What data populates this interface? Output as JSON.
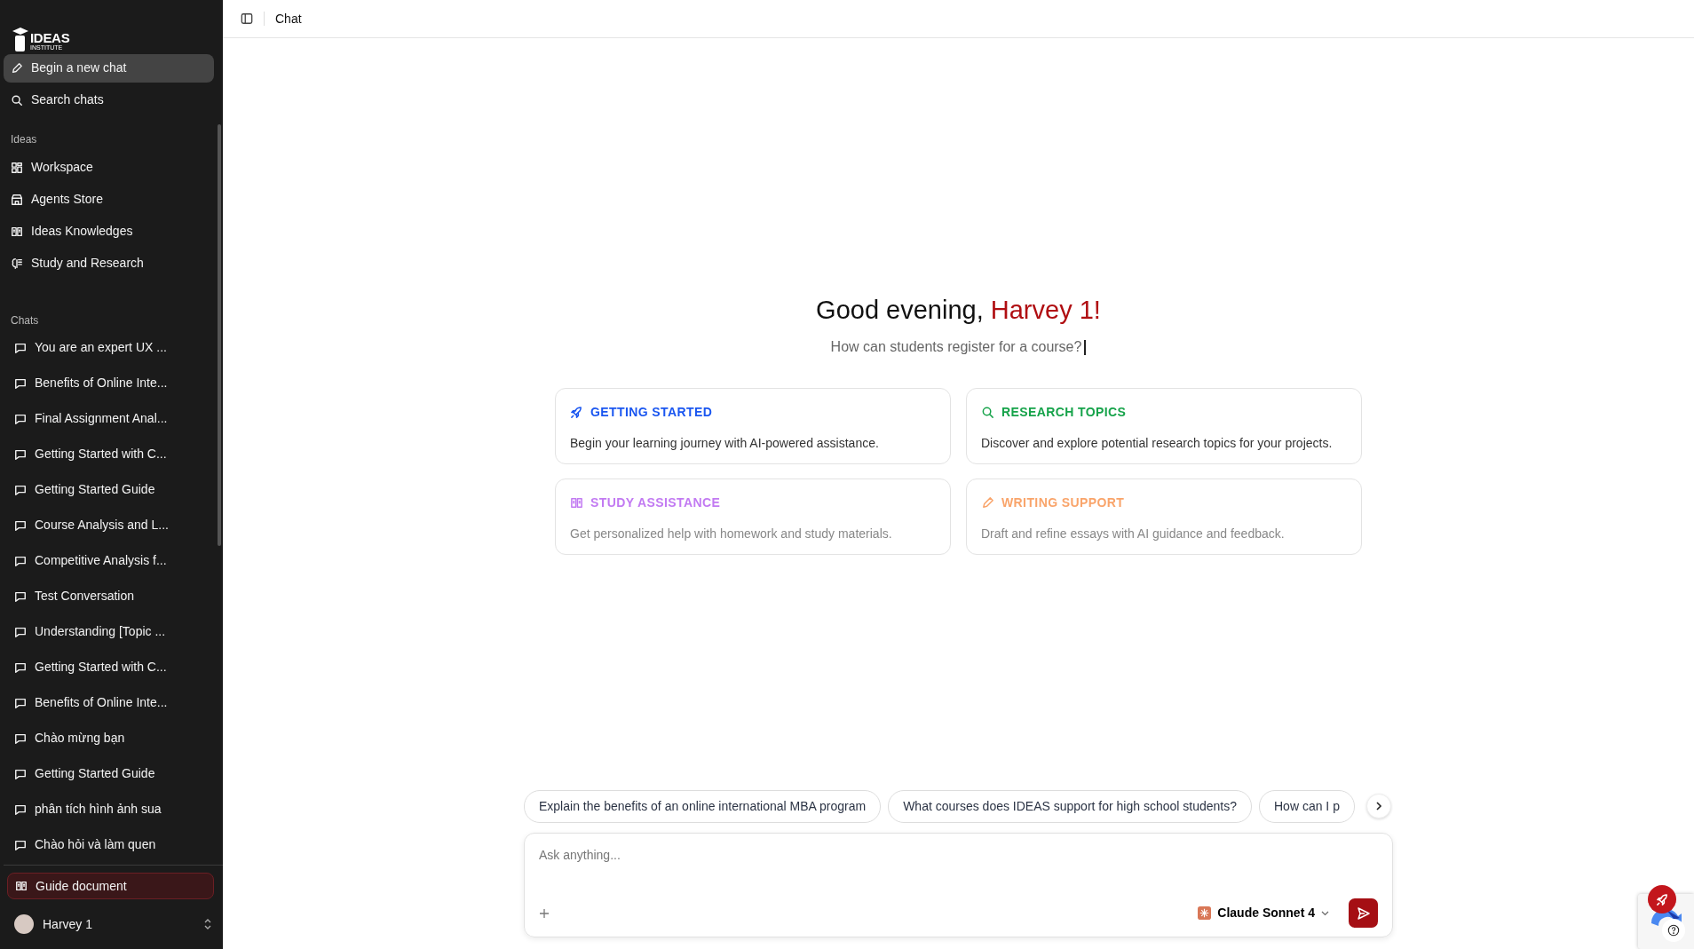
{
  "logo": {
    "title": "IDEAS",
    "subtitle": "INSTITUTE"
  },
  "sidebar": {
    "actions": [
      {
        "label": "Begin a new chat",
        "kind": "pencil",
        "selected": true
      },
      {
        "label": "Search chats",
        "kind": "search",
        "selected": false
      }
    ],
    "sections": [
      {
        "heading": "Ideas",
        "items": [
          {
            "label": "Workspace",
            "kind": "grid"
          },
          {
            "label": "Agents Store",
            "kind": "store"
          },
          {
            "label": "Ideas Knowledges",
            "kind": "book"
          },
          {
            "label": "Study and Research",
            "kind": "brain"
          }
        ]
      },
      {
        "heading": "Chats",
        "items": [
          {
            "label": "You are an expert UX ...",
            "kind": "chat"
          },
          {
            "label": "Benefits of Online Inte...",
            "kind": "chat"
          },
          {
            "label": "Final Assignment Anal...",
            "kind": "chat"
          },
          {
            "label": "Getting Started with C...",
            "kind": "chat"
          },
          {
            "label": "Getting Started Guide",
            "kind": "chat"
          },
          {
            "label": "Course Analysis and L...",
            "kind": "chat"
          },
          {
            "label": "Competitive Analysis f...",
            "kind": "chat"
          },
          {
            "label": "Test Conversation",
            "kind": "chat"
          },
          {
            "label": "Understanding [Topic ...",
            "kind": "chat"
          },
          {
            "label": "Getting Started with C...",
            "kind": "chat"
          },
          {
            "label": "Benefits of Online Inte...",
            "kind": "chat"
          },
          {
            "label": "Chào mừng bạn",
            "kind": "chat"
          },
          {
            "label": "Getting Started Guide",
            "kind": "chat"
          },
          {
            "label": "phân tích hình ảnh sua",
            "kind": "chat"
          },
          {
            "label": "Chào hỏi và làm quen",
            "kind": "chat"
          }
        ]
      }
    ],
    "guide": {
      "label": "Guide document"
    },
    "user": {
      "name": "Harvey 1"
    }
  },
  "header": {
    "title": "Chat"
  },
  "greeting": {
    "text": "Good evening,",
    "name": "Harvey 1!"
  },
  "typing_prompt": "How can students register for a course?",
  "cards": [
    {
      "title": "GETTING STARTED",
      "text": "Begin your learning journey with AI-powered assistance.",
      "kind": "rocket",
      "color": "#1a56f0",
      "faded": false
    },
    {
      "title": "RESEARCH TOPICS",
      "text": "Discover and explore potential research topics for your projects.",
      "kind": "search",
      "color": "#16a34a",
      "faded": false
    },
    {
      "title": "STUDY ASSISTANCE",
      "text": "Get personalized help with homework and study materials.",
      "kind": "book",
      "color": "#c27af2",
      "faded": true
    },
    {
      "title": "WRITING SUPPORT",
      "text": "Draft and refine essays with AI guidance and feedback.",
      "kind": "pencil",
      "color": "#f9a46a",
      "faded": true
    }
  ],
  "suggestions": [
    "Explain the benefits of an online international MBA program",
    "What courses does IDEAS support for high school students?",
    "How can I p"
  ],
  "composer": {
    "placeholder": "Ask anything...",
    "model": "Claude Sonnet 4"
  }
}
